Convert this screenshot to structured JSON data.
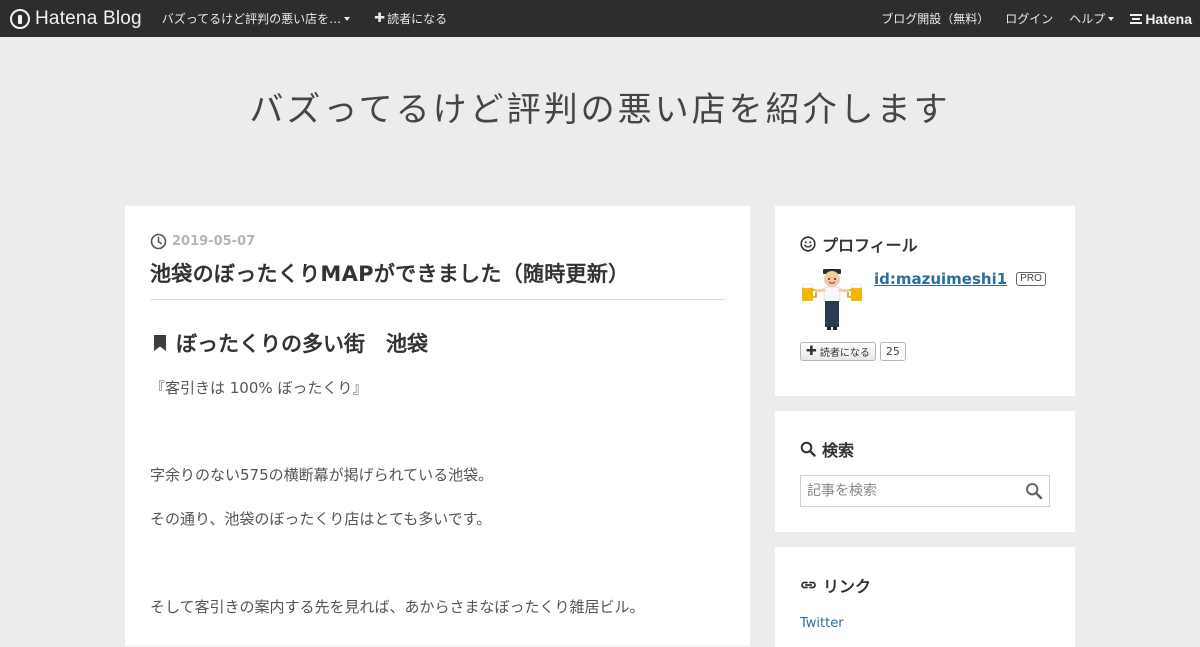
{
  "topbar": {
    "logo_text": "Hatena Blog",
    "blog_menu_label": "バズってるけど評判の悪い店を…",
    "subscribe_label": "読者になる",
    "open_blog_label": "ブログ開設（無料）",
    "login_label": "ログイン",
    "help_label": "ヘルプ",
    "brand_label": "Hatena"
  },
  "blog": {
    "title": "バズってるけど評判の悪い店を紹介します"
  },
  "entry": {
    "date": "2019-05-07",
    "title": "池袋のぼったくりMAPができました（随時更新）",
    "section_heading": "ぼったくりの多い街　池袋",
    "paragraphs": [
      "『客引きは 100% ぼったくり』",
      "字余りのない575の横断幕が掲げられている池袋。",
      "その通り、池袋のぼったくり店はとても多いです。",
      "そして客引きの案内する先を見れば、あからさまなぼったくり雑居ビル。"
    ]
  },
  "sidebar": {
    "profile": {
      "heading": "プロフィール",
      "user_id": "id:mazuimeshi1",
      "badge": "PRO",
      "subscribe_label": "読者になる",
      "subscriber_count": "25"
    },
    "search": {
      "heading": "検索",
      "placeholder": "記事を検索"
    },
    "links": {
      "heading": "リンク",
      "items": [
        "Twitter"
      ]
    }
  },
  "colors": {
    "topbar_bg": "#2d2d2d",
    "page_bg": "#ececec",
    "link": "#2a6f9d"
  },
  "icons": {
    "clock": "clock-icon",
    "bookmark": "bookmark-icon",
    "smile": "smile-icon",
    "search": "search-icon",
    "link": "link-icon"
  }
}
